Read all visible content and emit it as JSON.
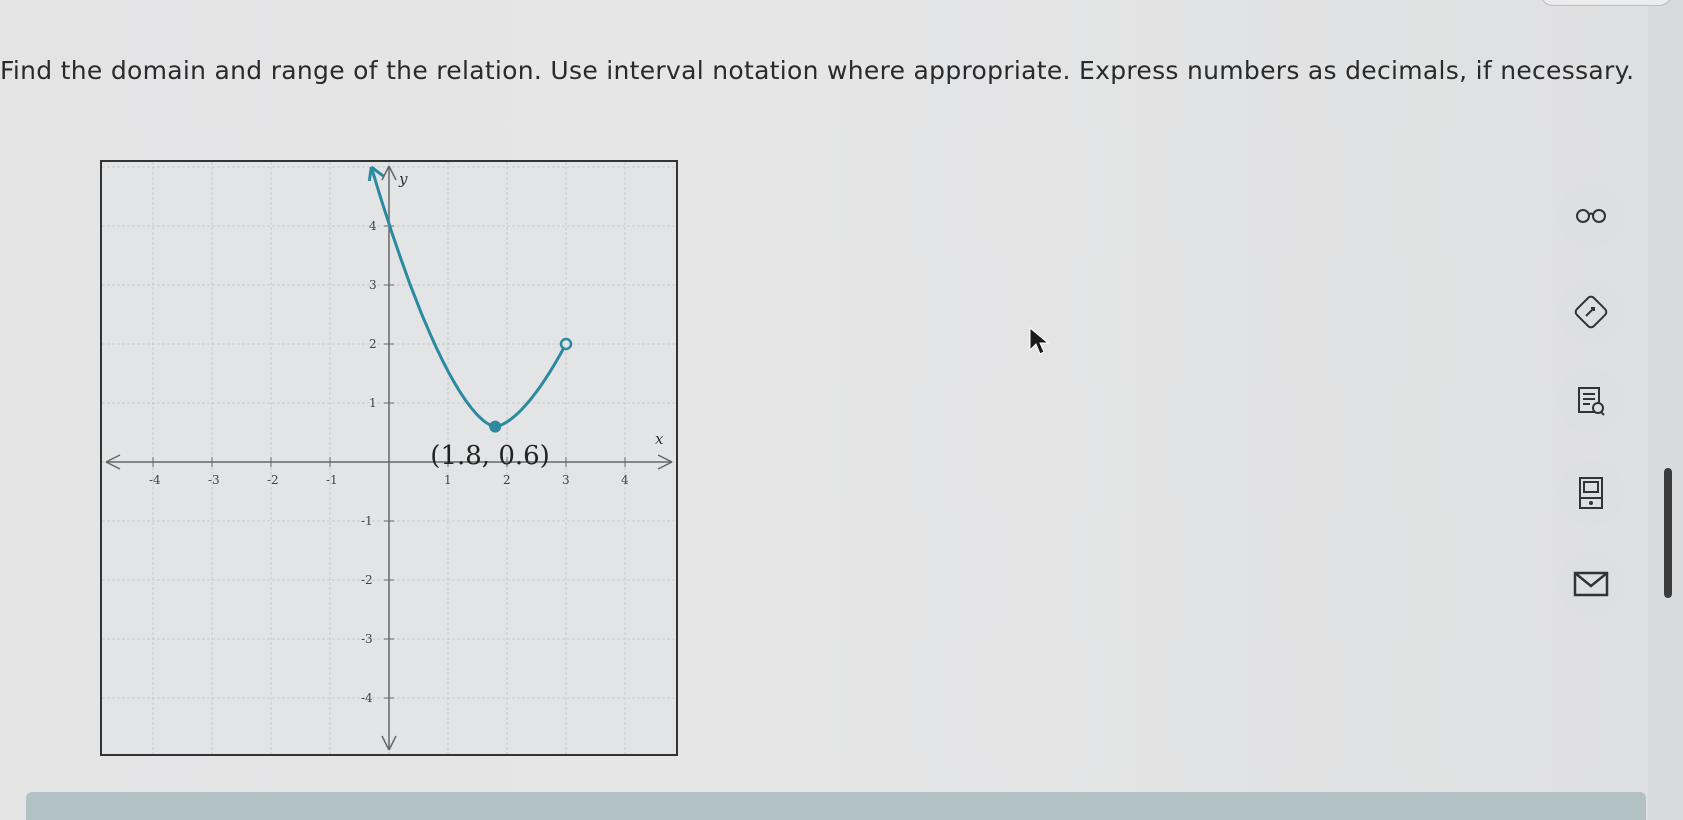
{
  "question": {
    "text": "Find the domain and range of the relation. Use interval notation where appropriate. Express numbers as decimals, if necessary."
  },
  "graph": {
    "x_axis_label": "x",
    "y_axis_label": "y",
    "x_ticks": [
      "-4",
      "-3",
      "-2",
      "-1",
      "1",
      "2",
      "3",
      "4"
    ],
    "y_ticks": [
      "4",
      "3",
      "2",
      "1",
      "-1",
      "-2",
      "-3",
      "-4"
    ],
    "point_label": "(1.8, 0.6)",
    "curve_color": "#2b8aa0",
    "vertex": {
      "x": 1.8,
      "y": 0.6,
      "closed": true
    },
    "right_endpoint": {
      "x": 3,
      "y": 2,
      "closed": false
    },
    "left_end": {
      "x": -0.3,
      "y": 5,
      "arrow": true
    }
  },
  "tools": [
    {
      "name": "glasses-icon"
    },
    {
      "name": "pencil-diamond-icon"
    },
    {
      "name": "notes-search-icon"
    },
    {
      "name": "calculator-book-icon"
    },
    {
      "name": "mail-icon"
    }
  ]
}
